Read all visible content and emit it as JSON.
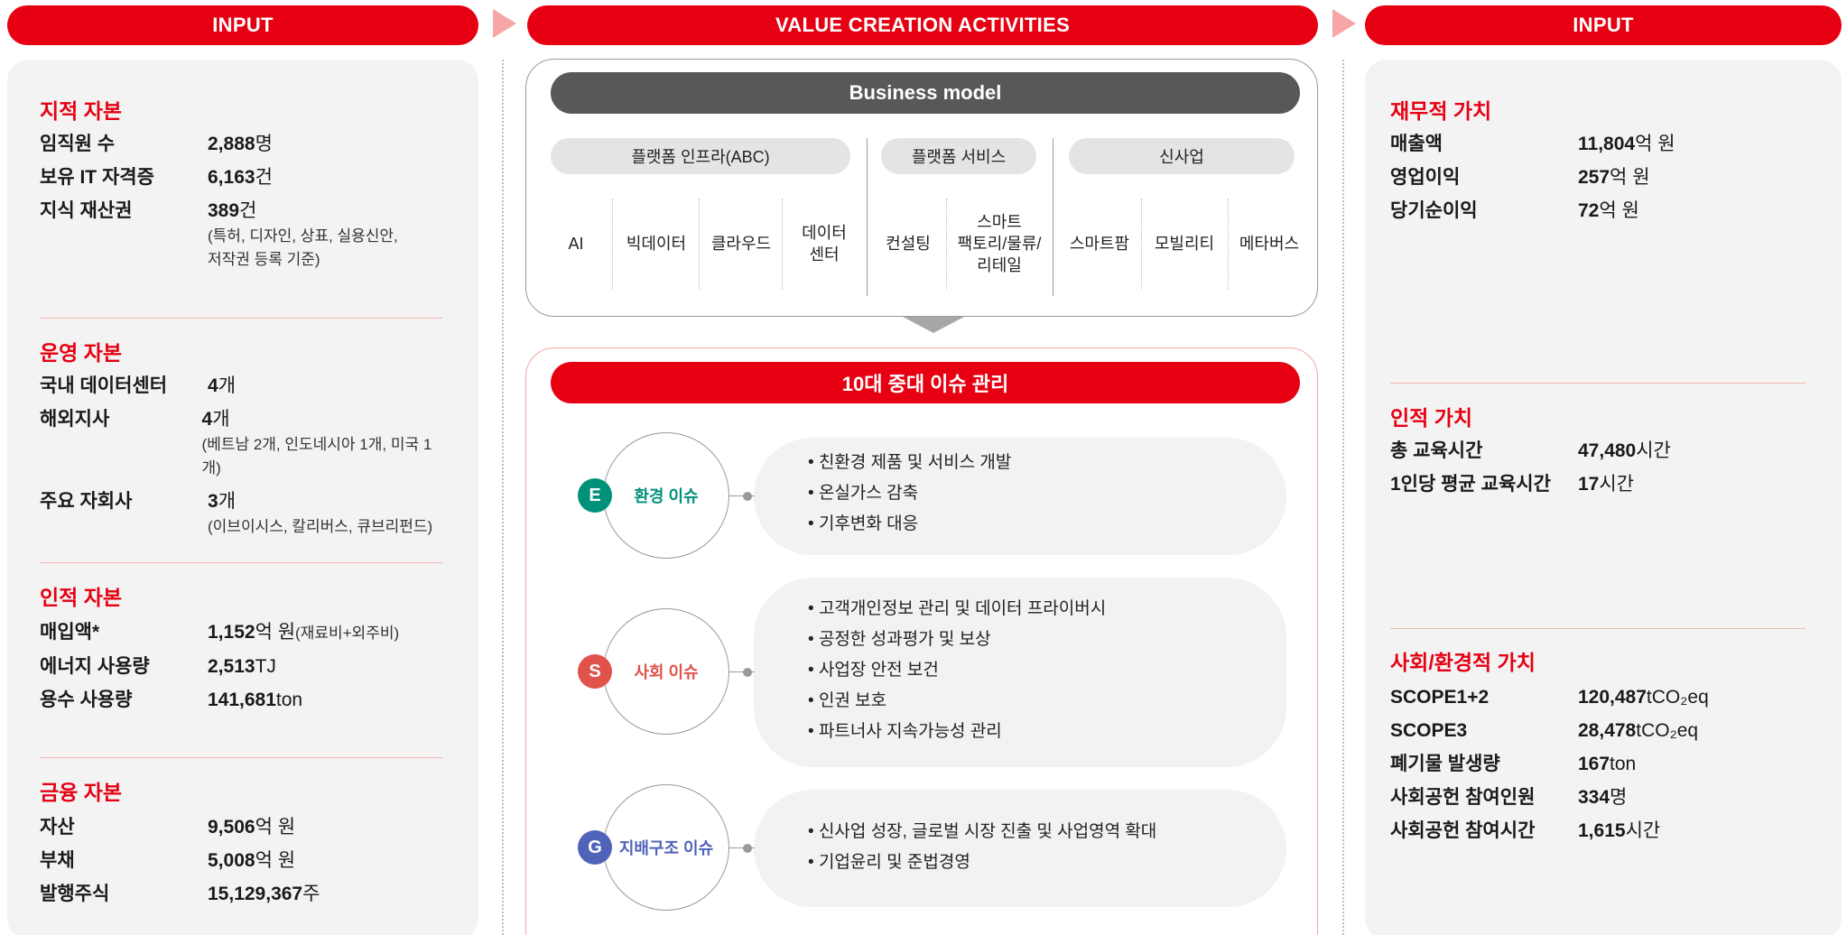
{
  "headers": {
    "left": "INPUT",
    "center": "VALUE CREATION ACTIVITIES",
    "right": "INPUT"
  },
  "left_panel": {
    "sections": [
      {
        "title": "지적 자본",
        "rows": [
          {
            "label": "임직원 수",
            "value": "2,888",
            "unit": "명",
            "note": ""
          },
          {
            "label": "보유 IT 자격증",
            "value": "6,163",
            "unit": "건",
            "note": ""
          },
          {
            "label": "지식 재산권",
            "value": "389",
            "unit": "건",
            "note": "(특허, 디자인, 상표, 실용신안,",
            "note2": "저작권 등록 기준)"
          }
        ]
      },
      {
        "title": "운영 자본",
        "rows": [
          {
            "label": "국내 데이터센터",
            "value": "4",
            "unit": "개",
            "note": ""
          },
          {
            "label": "해외지사",
            "value": "4",
            "unit": "개",
            "note": "(베트남 2개, 인도네시아 1개, 미국 1개)"
          },
          {
            "label": "주요 자회사",
            "value": "3",
            "unit": "개",
            "note": "(이브이시스, 칼리버스, 큐브리펀드)"
          }
        ]
      },
      {
        "title": "인적 자본",
        "rows": [
          {
            "label": "매입액*",
            "value": "1,152",
            "unit": "억 원",
            "suffix": "(재료비+외주비)"
          },
          {
            "label": "에너지 사용량",
            "value": "2,513",
            "unit": "TJ"
          },
          {
            "label": "용수 사용량",
            "value": "141,681",
            "unit": "ton"
          }
        ]
      },
      {
        "title": "금융 자본",
        "rows": [
          {
            "label": "자산",
            "value": "9,506",
            "unit": "억 원"
          },
          {
            "label": "부채",
            "value": "5,008",
            "unit": "억 원"
          },
          {
            "label": "발행주식",
            "value": "15,129,367",
            "unit": "주"
          }
        ]
      }
    ]
  },
  "business_model": {
    "title": "Business model",
    "categories": [
      "플랫폼 인프라(ABC)",
      "플랫폼 서비스",
      "신사업"
    ],
    "items": [
      "AI",
      "빅데이터",
      "클라우드",
      "데이터\n센터",
      "컨설팅",
      "스마트\n팩토리/물류/\n리테일",
      "스마트팜",
      "모빌리티",
      "메타버스"
    ]
  },
  "issues": {
    "title": "10대 중대 이슈 관리",
    "groups": [
      {
        "badge": "E",
        "label": "환경 이슈",
        "color": "#00917a",
        "items": [
          "친환경 제품 및 서비스 개발",
          "온실가스 감축",
          "기후변화 대응"
        ]
      },
      {
        "badge": "S",
        "label": "사회 이슈",
        "color": "#e0524a",
        "items": [
          "고객개인정보 관리 및 데이터 프라이버시",
          "공정한 성과평가 및 보상",
          "사업장 안전 보건",
          "인권 보호",
          "파트너사 지속가능성 관리"
        ]
      },
      {
        "badge": "G",
        "label": "지배구조 이슈",
        "color": "#4f63b8",
        "items": [
          "신사업 성장, 글로벌 시장 진출 및 사업영역 확대",
          "기업윤리 및 준법경영"
        ]
      }
    ]
  },
  "right_panel": {
    "sections": [
      {
        "title": "재무적 가치",
        "rows": [
          {
            "label": "매출액",
            "value": "11,804",
            "unit": "억 원"
          },
          {
            "label": "영업이익",
            "value": "257",
            "unit": "억 원"
          },
          {
            "label": "당기순이익",
            "value": "72",
            "unit": "억 원"
          }
        ]
      },
      {
        "title": "인적 가치",
        "rows": [
          {
            "label": "총 교육시간",
            "value": "47,480",
            "unit": "시간"
          },
          {
            "label": "1인당 평균 교육시간",
            "value": "17",
            "unit": "시간"
          }
        ]
      },
      {
        "title": "사회/환경적 가치",
        "rows": [
          {
            "label": "SCOPE1+2",
            "value": "120,487",
            "unit": "tCO₂eq"
          },
          {
            "label": "SCOPE3",
            "value": "28,478",
            "unit": "tCO₂eq"
          },
          {
            "label": "폐기물 발생량",
            "value": "167",
            "unit": "ton"
          },
          {
            "label": "사회공헌 참여인원",
            "value": "334",
            "unit": "명"
          },
          {
            "label": "사회공헌 참여시간",
            "value": "1,615",
            "unit": "시간"
          }
        ]
      }
    ]
  }
}
